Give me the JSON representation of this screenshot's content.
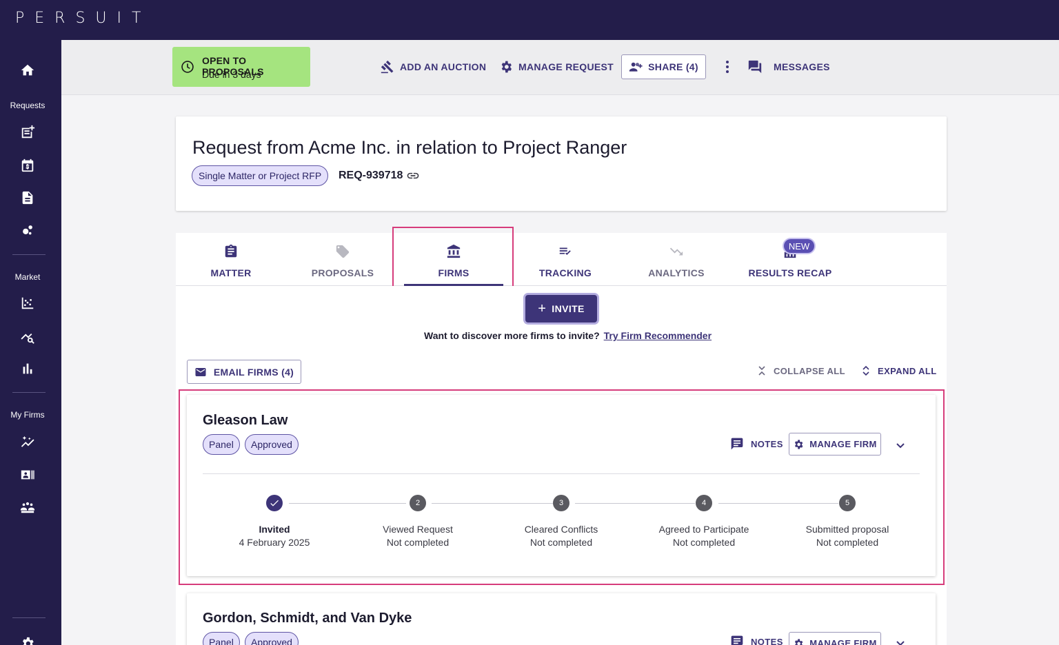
{
  "app": {
    "logo": "PERSUIT"
  },
  "sidebar": {
    "sections": [
      "Requests",
      "Market",
      "My Firms"
    ],
    "icons": [
      "home-icon",
      "new-request-icon",
      "billing-calendar-icon",
      "document-icon",
      "bubbles-icon",
      "scatter-chart-icon",
      "market-search-icon",
      "bar-chart-icon",
      "sparkle-chart-icon",
      "firm-directory-icon",
      "team-icon",
      "settings-icon"
    ]
  },
  "status": {
    "title": "OPEN TO PROPOSALS",
    "subtitle": "Due in 3 days",
    "color": "#a5e47f"
  },
  "actions": {
    "add_auction": "ADD AN AUCTION",
    "manage_request": "MANAGE REQUEST",
    "share": "SHARE (4)",
    "messages": "MESSAGES"
  },
  "request": {
    "title": "Request from Acme Inc. in relation to Project Ranger",
    "type_chip": "Single Matter or Project RFP",
    "id": "REQ-939718"
  },
  "tabs": [
    {
      "label": "MATTER",
      "icon": "clipboard-icon"
    },
    {
      "label": "PROPOSALS",
      "icon": "tag-icon"
    },
    {
      "label": "FIRMS",
      "icon": "bank-icon",
      "active": true
    },
    {
      "label": "TRACKING",
      "icon": "checklist-icon"
    },
    {
      "label": "ANALYTICS",
      "icon": "trend-down-icon"
    },
    {
      "label": "RESULTS RECAP",
      "icon": "bar-results-icon",
      "badge": "NEW"
    }
  ],
  "firms_panel": {
    "invite": "INVITE",
    "discover_text": "Want to discover more firms to invite?",
    "discover_link": "Try Firm Recommender",
    "email_firms": "EMAIL FIRMS (4)",
    "collapse_all": "COLLAPSE ALL",
    "expand_all": "EXPAND ALL"
  },
  "firms": [
    {
      "name": "Gleason Law",
      "chips": [
        "Panel",
        "Approved"
      ],
      "notes": "NOTES",
      "manage": "MANAGE FIRM",
      "steps": [
        {
          "num": "1",
          "name": "Invited",
          "status": "4 February 2025",
          "done": true
        },
        {
          "num": "2",
          "name": "Viewed Request",
          "status": "Not completed"
        },
        {
          "num": "3",
          "name": "Cleared Conflicts",
          "status": "Not completed"
        },
        {
          "num": "4",
          "name": "Agreed to Participate",
          "status": "Not completed"
        },
        {
          "num": "5",
          "name": "Submitted proposal",
          "status": "Not completed"
        }
      ]
    },
    {
      "name": "Gordon, Schmidt, and Van Dyke",
      "chips": [
        "Panel",
        "Approved"
      ],
      "notes": "NOTES",
      "manage": "MANAGE FIRM"
    }
  ],
  "colors": {
    "brand_dark": "#231d4a",
    "accent": "#3d3478",
    "highlight": "#d63c7b"
  }
}
